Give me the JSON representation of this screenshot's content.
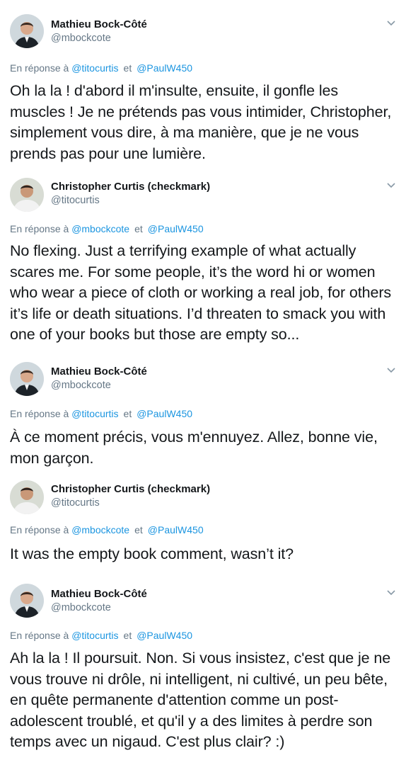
{
  "icons": {
    "more_menu": "chevron-down-icon",
    "avatar_mathieu": "user-photo-suit",
    "avatar_christopher": "user-photo-white-shirt"
  },
  "colors": {
    "link": "#1b95e0",
    "secondary_text": "#657786",
    "primary_text": "#14171a"
  },
  "reply_prefix": "En réponse à",
  "reply_conj": "et",
  "tweets": [
    {
      "name": "Mathieu Bock-Côté",
      "handle": "@mbockcote",
      "reply_to_1": "@titocurtis",
      "reply_to_2": "@PaulW450",
      "text": "Oh la la ! d'abord il m'insulte, ensuite, il gonfle les muscles ! Je ne prétends pas vous intimider, Christopher, simplement vous dire, à ma manière, que je ne vous prends pas pour une lumière."
    },
    {
      "name": "Christopher Curtis (checkmark)",
      "handle": "@titocurtis",
      "reply_to_1": "@mbockcote",
      "reply_to_2": "@PaulW450",
      "text": "No flexing. Just a terrifying example of what actually scares me. For some people, it’s the word hi or women who wear a piece of cloth or working a real job, for others it’s life or death situations. I’d threaten to smack you with one of your books but those are empty so..."
    },
    {
      "name": "Mathieu Bock-Côté",
      "handle": "@mbockcote",
      "reply_to_1": "@titocurtis",
      "reply_to_2": "@PaulW450",
      "text": "À ce moment précis, vous m'ennuyez. Allez, bonne vie, mon garçon."
    },
    {
      "name": "Christopher Curtis (checkmark)",
      "handle": "@titocurtis",
      "reply_to_1": "@mbockcote",
      "reply_to_2": "@PaulW450",
      "text": "It was the empty book comment, wasn’t it?"
    },
    {
      "name": "Mathieu Bock-Côté",
      "handle": "@mbockcote",
      "reply_to_1": "@titocurtis",
      "reply_to_2": "@PaulW450",
      "text": "Ah la la ! Il poursuit. Non. Si vous insistez, c'est que je ne vous trouve ni drôle, ni intelligent, ni cultivé, un peu bête, en quête permanente d'attention comme un post-adolescent troublé, et qu'il y a des limites à perdre son temps avec un nigaud. C'est plus clair? :)"
    }
  ]
}
